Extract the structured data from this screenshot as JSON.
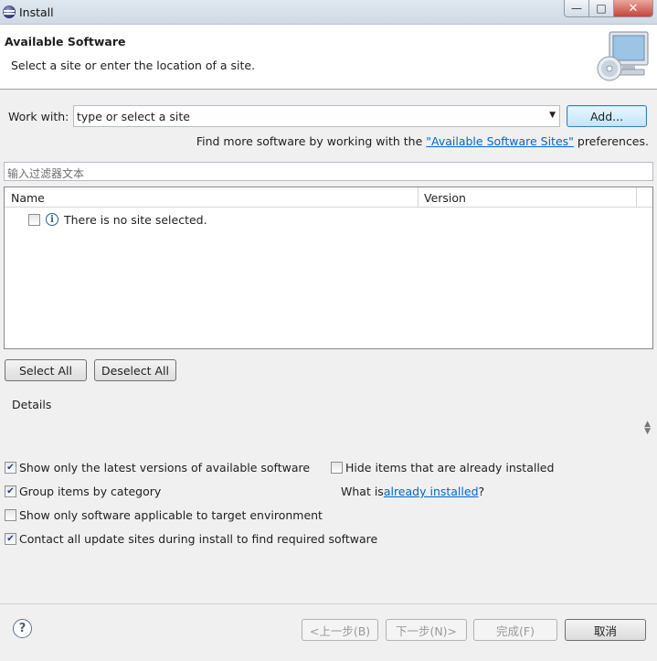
{
  "window": {
    "title": "Install",
    "controls": {
      "minimize": "—",
      "maximize": "□",
      "close": "✕"
    }
  },
  "header": {
    "title": "Available Software",
    "description": "Select a site or enter the location of a site."
  },
  "work_with": {
    "label": "Work with:",
    "value": "type or select a site",
    "add_button": "Add...",
    "find_more_prefix": "Find more software by working with the ",
    "find_more_link": "\"Available Software Sites\"",
    "find_more_suffix": " preferences."
  },
  "filter": {
    "placeholder": "输入过滤器文本"
  },
  "tree": {
    "columns": [
      "Name",
      "Version"
    ],
    "rows": [
      {
        "label": "There is no site selected.",
        "checked": false,
        "icon": "info-icon"
      }
    ]
  },
  "buttons": {
    "select_all": "Select All",
    "deselect_all": "Deselect All"
  },
  "details": {
    "label": "Details"
  },
  "options": {
    "latest_versions": {
      "label": "Show only the latest versions of available software",
      "checked": true
    },
    "hide_installed": {
      "label": "Hide items that are already installed",
      "checked": false
    },
    "group_category": {
      "label": "Group items by category",
      "checked": true
    },
    "what_is_prefix": "What is ",
    "what_is_link": "already installed",
    "what_is_suffix": "?",
    "target_env": {
      "label": "Show only software applicable to target environment",
      "checked": false
    },
    "contact_sites": {
      "label": "Contact all update sites during install to find required software",
      "checked": true
    }
  },
  "footer": {
    "help_icon": "?",
    "back": "<上一步(B)",
    "next": "下一步(N)>",
    "finish": "完成(F)",
    "cancel": "取消"
  },
  "colors": {
    "link": "#0066cc",
    "close_button": "#c8443a",
    "focus_border": "#3c7fb1"
  }
}
